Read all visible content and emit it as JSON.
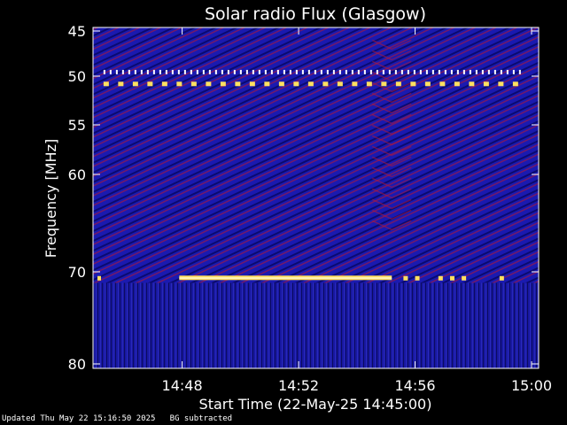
{
  "chart_data": {
    "type": "heatmap",
    "title": "Solar radio Flux (Glasgow)",
    "xlabel": "Start Time (22-May-25 14:45:00)",
    "ylabel": "Frequency [MHz]",
    "x_range": [
      "14:45:00",
      "15:00:00"
    ],
    "y_range_mhz": [
      45,
      80
    ],
    "y_ticks": [
      "45",
      "50",
      "55",
      "60",
      "70",
      "80"
    ],
    "x_ticks": [
      "14:48",
      "14:52",
      "14:56",
      "15:00"
    ],
    "x_tick_minutes": [
      3,
      7,
      11,
      15
    ],
    "y_tick_values": [
      45,
      50,
      55,
      60,
      70,
      80
    ],
    "features": [
      {
        "frequency_mhz": 49.6,
        "kind": "dashed-white-line",
        "start_min": 0.3,
        "end_min": 14.7
      },
      {
        "frequency_mhz": 50.8,
        "kind": "dashed-yellow-line",
        "start_min": 0.3,
        "end_min": 14.7
      },
      {
        "frequency_mhz": 70.7,
        "kind": "solid-yellow-band",
        "start_min": 2.9,
        "end_min": 10.2
      },
      {
        "frequency_mhz": 70.7,
        "kind": "sporadic-yellow-dots",
        "start_min": 10.5,
        "end_min": 14.5
      }
    ],
    "colors": {
      "background": "#1a1ab0",
      "stripe_dark": "#0a0a70",
      "stripe_red": "#b01838",
      "hot": "#ffe060",
      "white": "#ffffff"
    }
  },
  "footer": "Updated Thu May 22 15:16:50 2025   BG subtracted"
}
